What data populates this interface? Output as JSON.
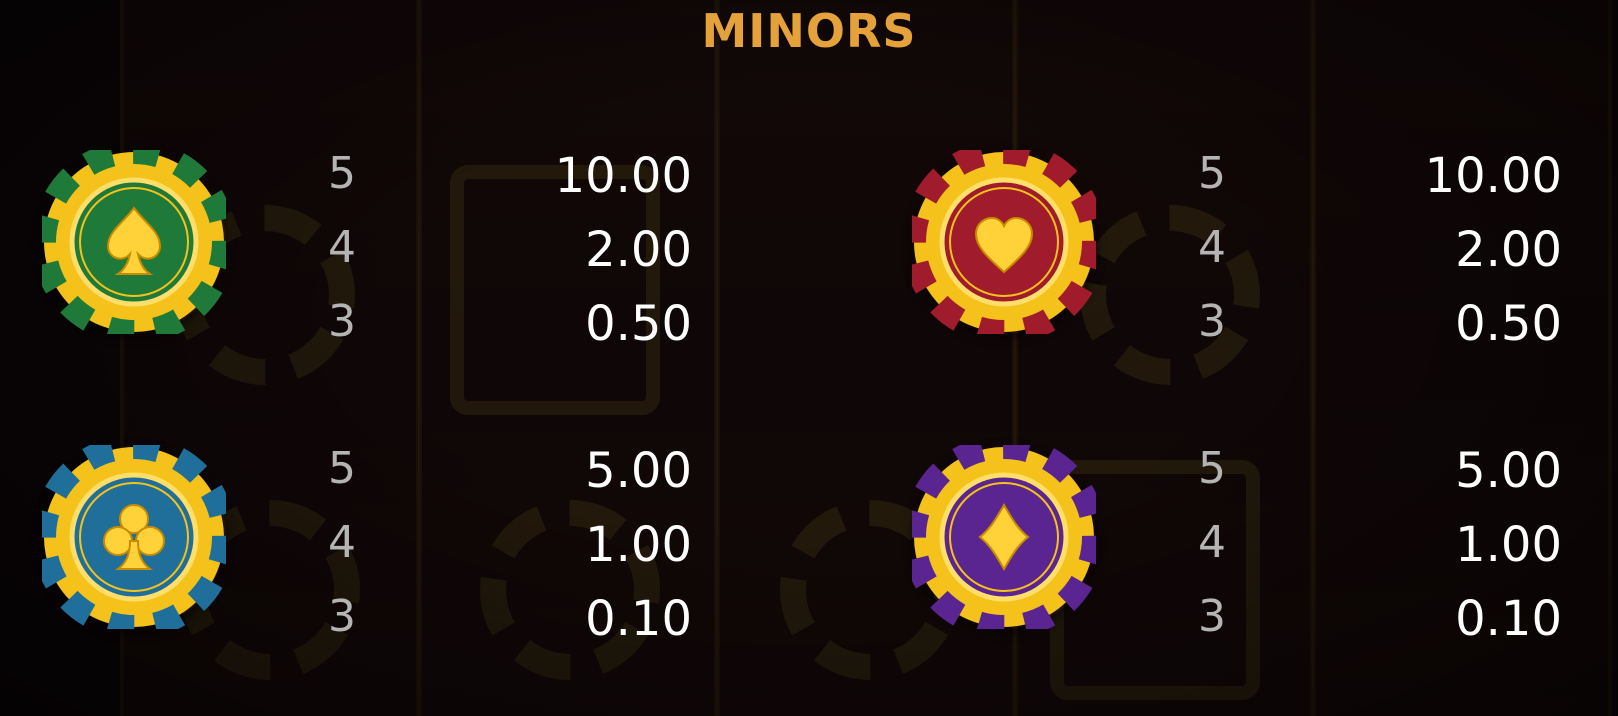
{
  "title": "MINORS",
  "colors": {
    "title": "#e6a23a",
    "count": "#b4b4b4",
    "value": "#ffffff",
    "gold": "#f5c518"
  },
  "symbols": [
    {
      "name": "spade",
      "icon": "spade-icon",
      "color": "#1f7a3a",
      "pays": [
        {
          "count": "5",
          "value": "10.00"
        },
        {
          "count": "4",
          "value": "2.00"
        },
        {
          "count": "3",
          "value": "0.50"
        }
      ]
    },
    {
      "name": "heart",
      "icon": "heart-icon",
      "color": "#a01c2c",
      "pays": [
        {
          "count": "5",
          "value": "10.00"
        },
        {
          "count": "4",
          "value": "2.00"
        },
        {
          "count": "3",
          "value": "0.50"
        }
      ]
    },
    {
      "name": "club",
      "icon": "club-icon",
      "color": "#1f6f9a",
      "pays": [
        {
          "count": "5",
          "value": "5.00"
        },
        {
          "count": "4",
          "value": "1.00"
        },
        {
          "count": "3",
          "value": "0.10"
        }
      ]
    },
    {
      "name": "diamond",
      "icon": "diamond-icon",
      "color": "#5a2590",
      "pays": [
        {
          "count": "5",
          "value": "5.00"
        },
        {
          "count": "4",
          "value": "1.00"
        },
        {
          "count": "3",
          "value": "0.10"
        }
      ]
    }
  ]
}
